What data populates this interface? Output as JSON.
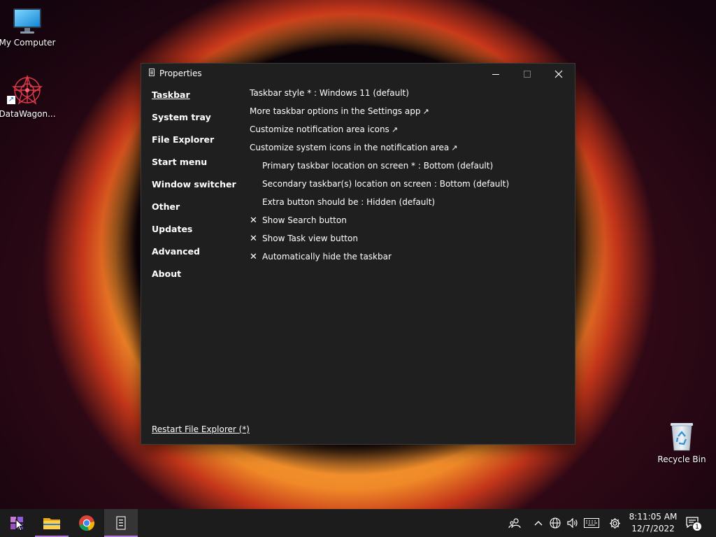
{
  "desktop": {
    "icons": [
      {
        "label": "My Computer",
        "icon": "monitor-icon"
      },
      {
        "label": "DataWagon...",
        "icon": "datawagon-icon"
      },
      {
        "label": "Recycle Bin",
        "icon": "recycle-bin-icon"
      }
    ]
  },
  "window": {
    "title": "Properties",
    "nav": [
      "Taskbar",
      "System tray",
      "File Explorer",
      "Start menu",
      "Window switcher",
      "Other",
      "Updates",
      "Advanced",
      "About"
    ],
    "active_nav": "Taskbar",
    "options": [
      {
        "text": "Taskbar style * : Windows 11 (default)"
      },
      {
        "text": "More taskbar options in the Settings app",
        "arrow": "↗"
      },
      {
        "text": "Customize notification area icons",
        "arrow": "↗"
      },
      {
        "text": "Customize system icons in the notification area",
        "arrow": "↗"
      },
      {
        "text": "Primary taskbar location on screen * : Bottom (default)"
      },
      {
        "text": "Secondary taskbar(s) location on screen : Bottom (default)"
      },
      {
        "text": "Extra button should be : Hidden (default)"
      },
      {
        "text": "Show Search button",
        "mark": "✕"
      },
      {
        "text": "Show Task view button",
        "mark": "✕"
      },
      {
        "text": "Automatically hide the taskbar",
        "mark": "✕"
      }
    ],
    "restart_label": "Restart File Explorer (*)"
  },
  "taskbar": {
    "apps": [
      "start-button",
      "file-explorer",
      "chrome",
      "properties"
    ],
    "tray": {
      "time": "8:11:05 AM",
      "date": "12/7/2022",
      "notification_count": "1"
    }
  },
  "colors": {
    "window_bg": "#1f1f1f",
    "taskbar_bg": "#1c1c1c",
    "accent": "#b27ad8"
  }
}
